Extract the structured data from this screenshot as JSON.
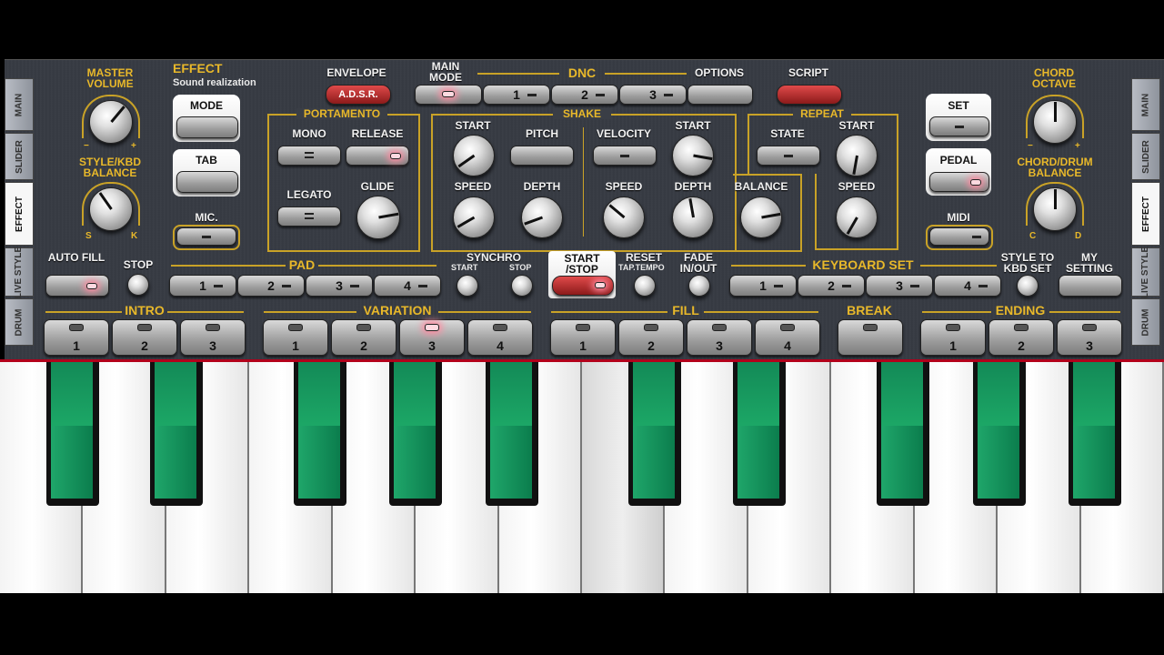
{
  "tabs_left": [
    "MAIN",
    "SLIDER",
    "EFFECT",
    "LIVE STYLE",
    "DRUM"
  ],
  "tabs_right": [
    "MAIN",
    "SLIDER",
    "EFFECT",
    "LIVE STYLE",
    "DRUM"
  ],
  "active_tab": "EFFECT",
  "master_volume": {
    "label": "MASTER VOLUME",
    "minus": "−",
    "plus": "+"
  },
  "style_kbd_balance": {
    "label": "STYLE/KBD BALANCE",
    "left": "S",
    "right": "K"
  },
  "effect": {
    "title": "EFFECT",
    "subtitle": "Sound realization",
    "mode": "MODE",
    "tab": "TAB",
    "mic": "MIC."
  },
  "envelope": {
    "label": "ENVELOPE",
    "button": "A.D.S.R."
  },
  "main_mode": "MAIN MODE",
  "dnc": {
    "label": "DNC",
    "buttons": [
      "1",
      "2",
      "3"
    ]
  },
  "options": "OPTIONS",
  "script": "SCRIPT",
  "portamento": {
    "label": "PORTAMENTO",
    "mono": "MONO",
    "release": "RELEASE",
    "legato": "LEGATO",
    "glide": "GLIDE"
  },
  "shake": {
    "label": "SHAKE",
    "start": "START",
    "pitch": "PITCH",
    "speed": "SPEED",
    "depth": "DEPTH",
    "velocity": "VELOCITY",
    "start2": "START",
    "speed2": "SPEED",
    "depth2": "DEPTH",
    "balance": "BALANCE"
  },
  "repeat": {
    "label": "REPEAT",
    "state": "STATE",
    "start": "START",
    "speed": "SPEED"
  },
  "set": "SET",
  "pedal": "PEDAL",
  "midi": "MIDI",
  "chord_octave": {
    "label": "CHORD OCTAVE",
    "minus": "−",
    "plus": "+"
  },
  "chord_drum_balance": {
    "label": "CHORD/DRUM BALANCE",
    "left": "C",
    "right": "D"
  },
  "auto_fill": "AUTO FILL",
  "stop": "STOP",
  "pad": {
    "label": "PAD",
    "buttons": [
      "1",
      "2",
      "3",
      "4"
    ]
  },
  "synchro": {
    "label": "SYNCHRO",
    "start": "START",
    "stop": "STOP"
  },
  "start_stop": "START /STOP",
  "reset": {
    "label": "RESET",
    "sub": "TAP.TEMPO"
  },
  "fade": "FADE IN/OUT",
  "keyboard_set": {
    "label": "KEYBOARD SET",
    "buttons": [
      "1",
      "2",
      "3",
      "4"
    ]
  },
  "style_to_kbd": "STYLE TO KBD SET",
  "my_setting": "MY SETTING",
  "intro": {
    "label": "INTRO",
    "buttons": [
      "1",
      "2",
      "3"
    ]
  },
  "variation": {
    "label": "VARIATION",
    "buttons": [
      "1",
      "2",
      "3",
      "4"
    ],
    "active": "3"
  },
  "fill": {
    "label": "FILL",
    "buttons": [
      "1",
      "2",
      "3",
      "4"
    ]
  },
  "break": "BREAK",
  "ending": {
    "label": "ENDING",
    "buttons": [
      "1",
      "2",
      "3"
    ]
  },
  "colors": {
    "gold": "#c9a227",
    "panel": "#3a3e46",
    "black_key_green": "#139a5f",
    "led_on": "#ff8aa0"
  }
}
